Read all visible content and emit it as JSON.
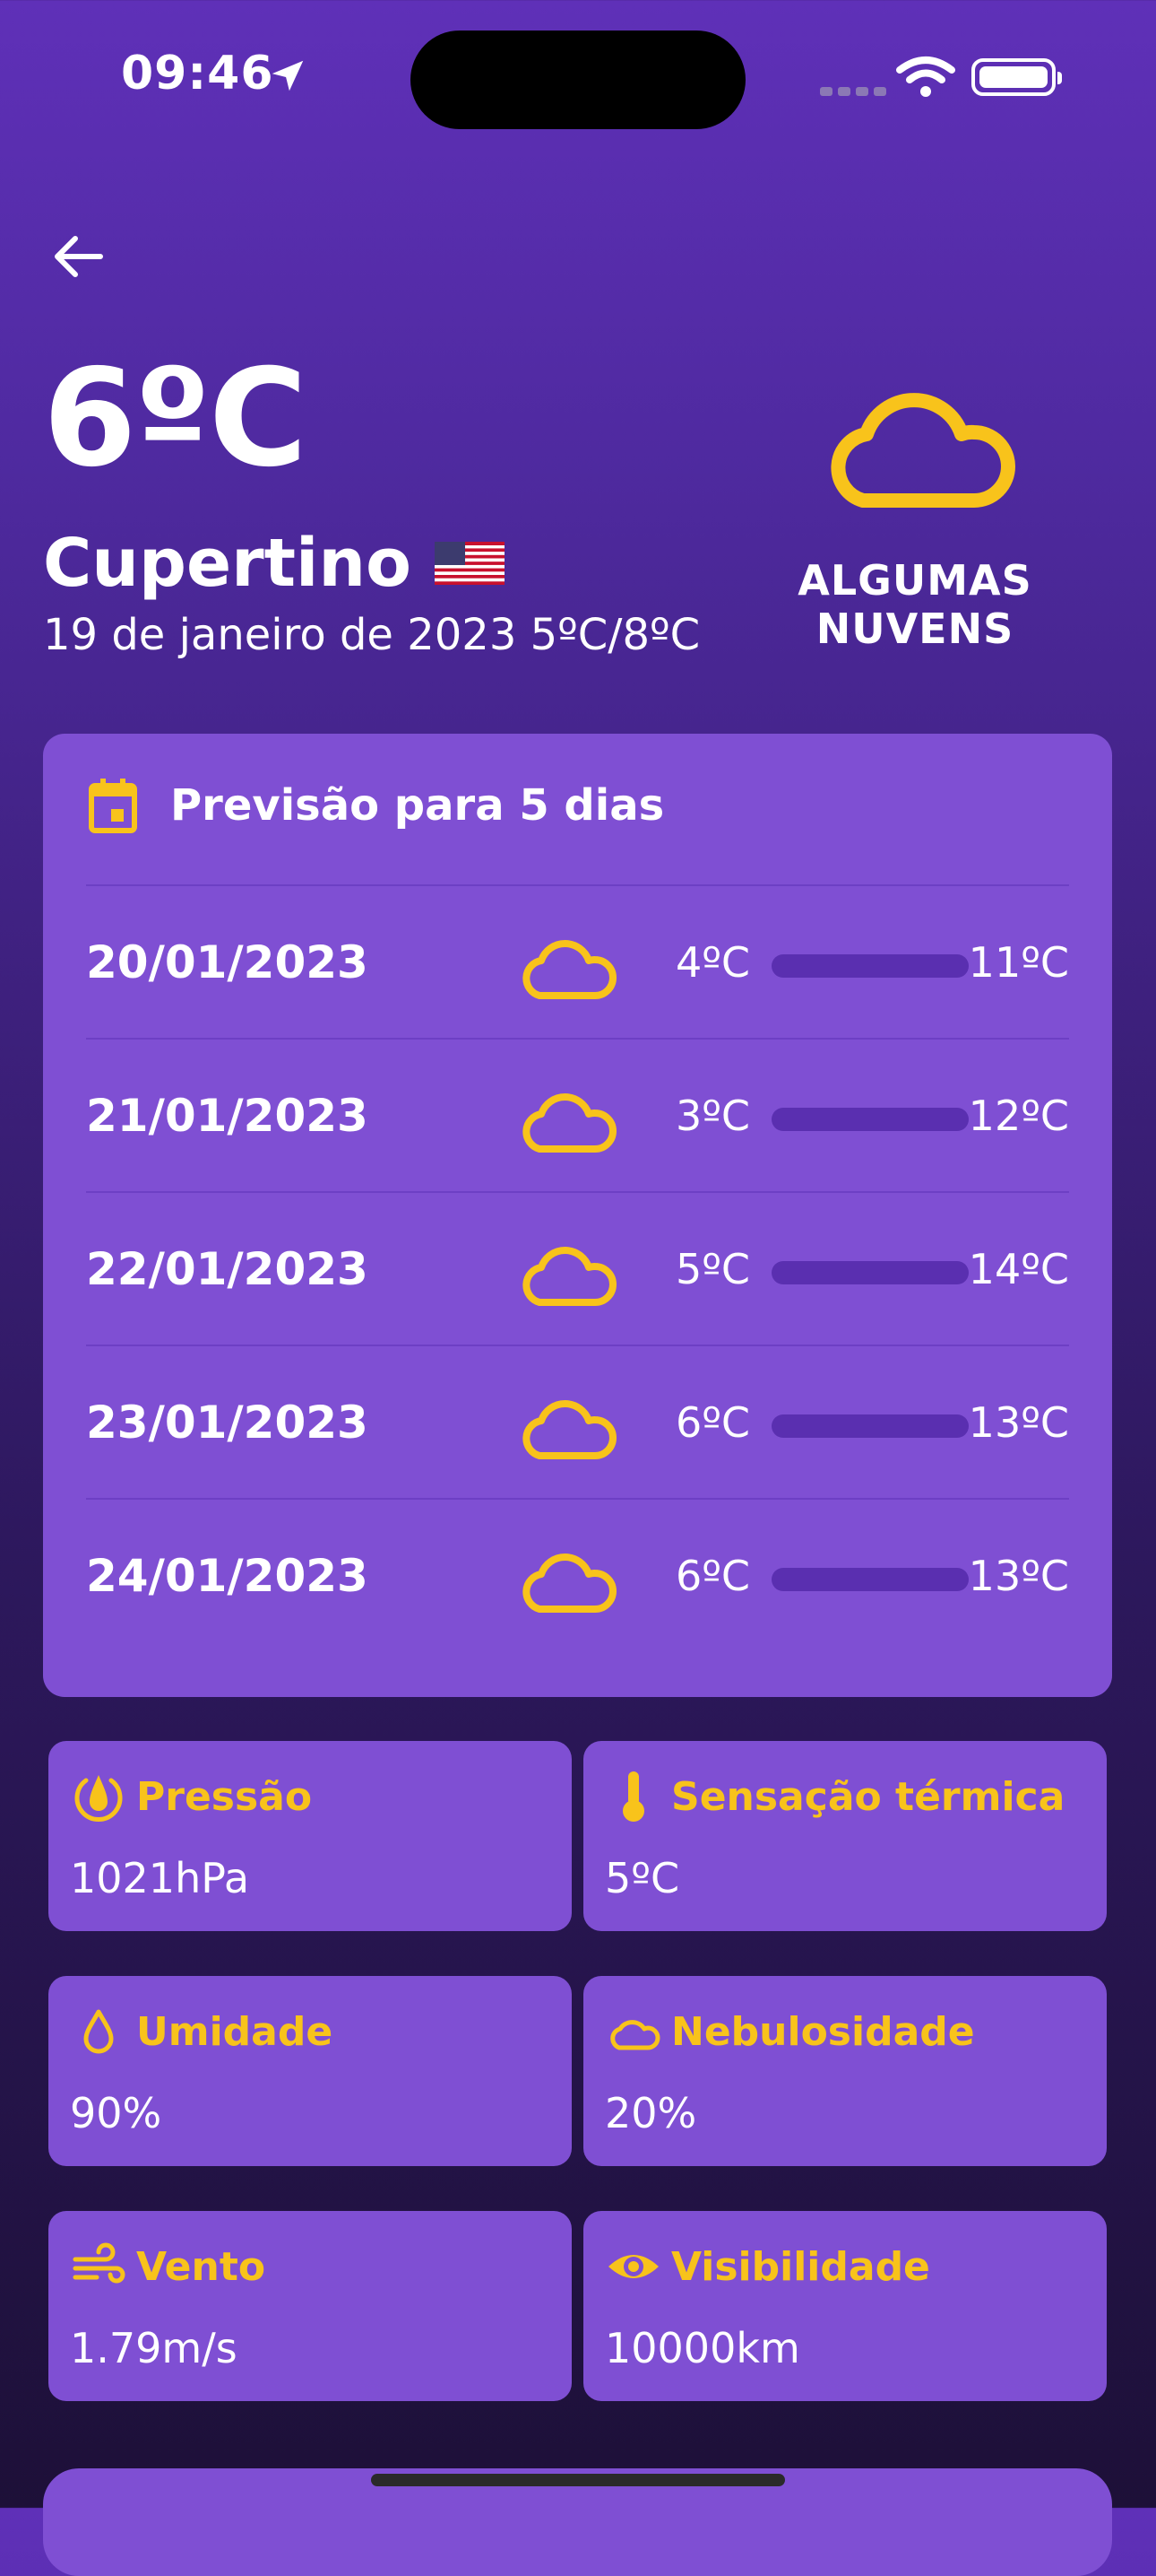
{
  "status_bar": {
    "time": "09:46"
  },
  "header": {
    "temperature": "6ºC",
    "city": "Cupertino",
    "date_range": "19 de janeiro de 2023 5ºC/8ºC",
    "condition": "ALGUMAS NUVENS"
  },
  "forecast": {
    "title": "Previsão para 5 dias",
    "days": [
      {
        "date": "20/01/2023",
        "min": "4ºC",
        "max": "11ºC",
        "icon": "cloud-icon"
      },
      {
        "date": "21/01/2023",
        "min": "3ºC",
        "max": "12ºC",
        "icon": "cloud-icon"
      },
      {
        "date": "22/01/2023",
        "min": "5ºC",
        "max": "14ºC",
        "icon": "cloud-icon"
      },
      {
        "date": "23/01/2023",
        "min": "6ºC",
        "max": "13ºC",
        "icon": "cloud-icon"
      },
      {
        "date": "24/01/2023",
        "min": "6ºC",
        "max": "13ºC",
        "icon": "cloud-icon"
      }
    ]
  },
  "details": [
    {
      "label": "Pressão",
      "value": "1021hPa",
      "icon": "pressure-icon"
    },
    {
      "label": "Sensação térmica",
      "value": "5ºC",
      "icon": "thermometer-icon"
    },
    {
      "label": "Umidade",
      "value": "90%",
      "icon": "droplet-icon"
    },
    {
      "label": "Nebulosidade",
      "value": "20%",
      "icon": "cloud-icon"
    },
    {
      "label": "Vento",
      "value": "1.79m/s",
      "icon": "wind-icon"
    },
    {
      "label": "Visibilidade",
      "value": "10000km",
      "icon": "eye-icon"
    }
  ],
  "colors": {
    "accent": "#f8c31b",
    "card": "#7f4fd3",
    "background_top": "#5f30b8",
    "background_bottom": "#1d1038"
  }
}
